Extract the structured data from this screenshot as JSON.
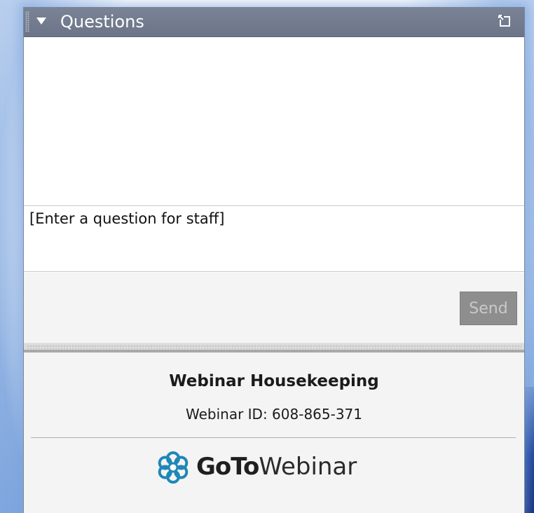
{
  "panel": {
    "title": "Questions",
    "collapse_icon": "triangle-down-icon",
    "popout_icon": "popout-window-icon"
  },
  "question": {
    "placeholder": "[Enter a question for staff]",
    "send_label": "Send"
  },
  "housekeeping": {
    "title": "Webinar Housekeeping",
    "webinar_id": "Webinar ID: 608-865-371"
  },
  "brand": {
    "logo_icon": "gotowebinar-flower-icon",
    "logo_bold": "GoTo",
    "logo_light": "Webinar",
    "accent_color": "#1f87b8"
  }
}
